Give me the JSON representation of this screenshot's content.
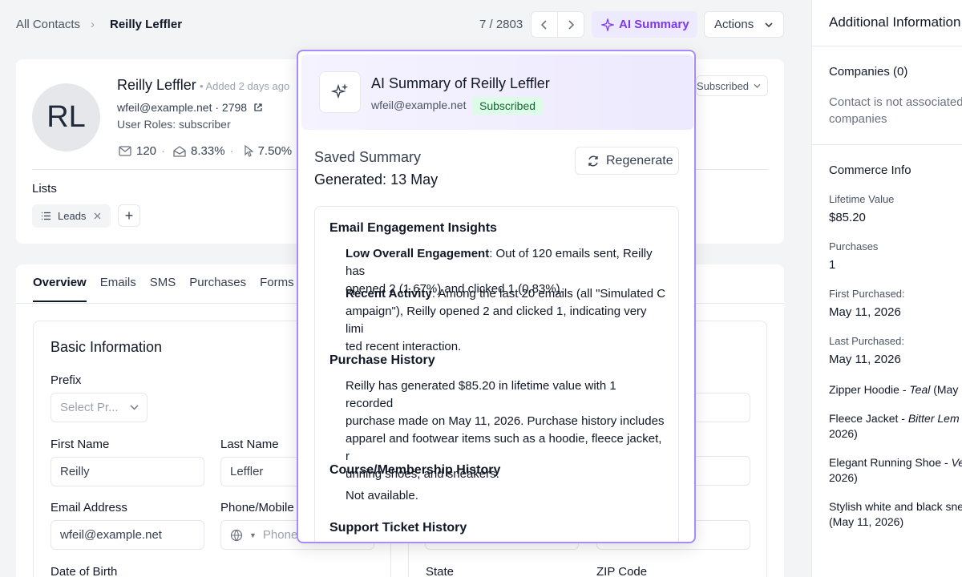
{
  "breadcrumb": {
    "root": "All Contacts",
    "separator": "›",
    "current": "Reilly Leffler"
  },
  "pager": {
    "count": "7 / 2803"
  },
  "toolbar": {
    "ai_summary": "AI Summary",
    "actions": "Actions"
  },
  "contact": {
    "initials": "RL",
    "name": "Reilly Leffler",
    "added": "• Added 2 days ago",
    "email_line": "wfeil@example.net · 2798",
    "roles": "User Roles: subscriber",
    "status_badge": "Subscribed",
    "stats": {
      "sent": "120",
      "open_rate": "8.33%",
      "click_rate": "7.50%"
    }
  },
  "lists": {
    "label": "Lists",
    "tags": [
      "Leads"
    ]
  },
  "tabs": [
    "Overview",
    "Emails",
    "SMS",
    "Purchases",
    "Forms"
  ],
  "basic_info": {
    "title": "Basic Information",
    "prefix": {
      "label": "Prefix",
      "placeholder": "Select Pr..."
    },
    "first_name": {
      "label": "First Name",
      "value": "Reilly"
    },
    "last_name": {
      "label": "Last Name",
      "value": "Leffler"
    },
    "email": {
      "label": "Email Address",
      "value": "wfeil@example.net"
    },
    "phone": {
      "label": "Phone/Mobile",
      "placeholder": "Phone"
    },
    "dob": {
      "label": "Date of Birth"
    },
    "state": {
      "label": "State"
    },
    "zip": {
      "label": "ZIP Code"
    }
  },
  "right_panel": {
    "title": "Additional Information",
    "companies_title": "Companies (0)",
    "companies_text_1": "Contact is not associated",
    "companies_text_2": "companies",
    "commerce_title": "Commerce Info",
    "lifetime_label": "Lifetime Value",
    "lifetime_value": "$85.20",
    "purchases_label": "Purchases",
    "purchases_value": "1",
    "first_purchased_label": "First Purchased:",
    "first_purchased_value": "May 11, 2026",
    "last_purchased_label": "Last Purchased:",
    "last_purchased_value": "May 11, 2026",
    "items": [
      {
        "name": "Zipper Hoodie - ",
        "variant": "Teal",
        "suffix": " (May",
        "line2": ""
      },
      {
        "name": "Fleece Jacket - ",
        "variant": "Bitter Lem",
        "suffix": "",
        "line2": "2026)"
      },
      {
        "name": "Elegant Running Shoe - ",
        "variant": "Ve",
        "suffix": "",
        "line2": "2026)"
      },
      {
        "name": "Stylish white and black sne",
        "variant": "",
        "suffix": "",
        "line2": "(May 11, 2026)"
      }
    ]
  },
  "ai_popover": {
    "title": "AI Summary of Reilly Leffler",
    "email": "wfeil@example.net",
    "badge": "Subscribed",
    "saved_label": "Saved Summary",
    "generated": "Generated: 13 May",
    "regenerate": "Regenerate",
    "sections": {
      "engagement_title": "Email Engagement Insights",
      "low_label": "Low Overall Engagement",
      "low_text_1": ": Out of 120 emails sent, Reilly has",
      "low_text_2": "opened 2 (1.67%) and clicked 1 (0.83%).",
      "recent_label": "Recent Activity",
      "recent_text_1": ": Among the last 20 emails (all \"Simulated C",
      "recent_text_2": "ampaign\"), Reilly opened 2 and clicked 1, indicating very limi",
      "recent_text_3": "ted recent interaction.",
      "purchase_title": "Purchase History",
      "purchase_1": "Reilly has generated $85.20 in lifetime value with 1 recorded",
      "purchase_2": "purchase made on May 11, 2026. Purchase history includes",
      "purchase_3": "apparel and footwear items such as a hoodie, fleece jacket, r",
      "purchase_4": "unning shoes, and sneakers.",
      "course_title": "Course/Membership History",
      "course_text": "Not available.",
      "support_title": "Support Ticket History"
    }
  }
}
